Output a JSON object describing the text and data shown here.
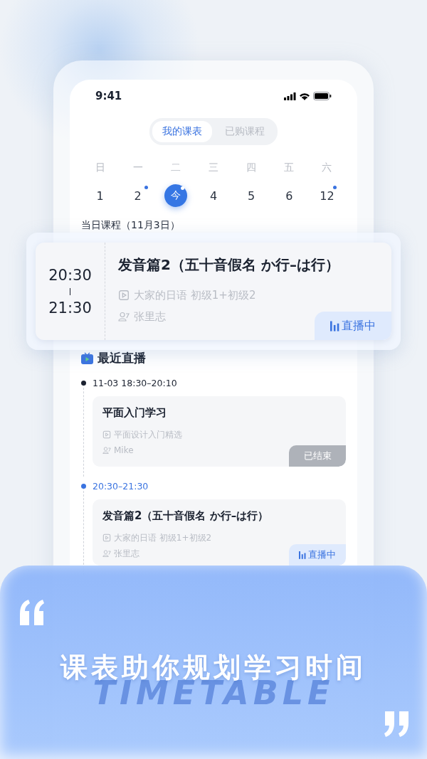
{
  "status_bar": {
    "time": "9:41"
  },
  "tabs": [
    {
      "label": "我的课表",
      "selected": true
    },
    {
      "label": "已购课程",
      "selected": false
    }
  ],
  "weekdays": [
    "日",
    "一",
    "二",
    "三",
    "四",
    "五",
    "六"
  ],
  "dates": [
    {
      "label": "1",
      "today": false,
      "has_class": false
    },
    {
      "label": "2",
      "today": false,
      "has_class": true
    },
    {
      "label": "今",
      "today": true,
      "has_class": true
    },
    {
      "label": "4",
      "today": false,
      "has_class": false
    },
    {
      "label": "5",
      "today": false,
      "has_class": false
    },
    {
      "label": "6",
      "today": false,
      "has_class": false
    },
    {
      "label": "12",
      "today": false,
      "has_class": true
    }
  ],
  "today_section": {
    "title": "当日课程（11月3日）"
  },
  "featured_course": {
    "start": "20:30",
    "end": "21:30",
    "title": "发音篇2（五十音假名 か行–は行）",
    "course": "大家的日语 初级1+初级2",
    "teacher": "张里志",
    "status": {
      "label": "直播中",
      "kind": "live"
    }
  },
  "recent": {
    "title": "最近直播",
    "items": [
      {
        "time": "11-03 18:30–20:10",
        "current": false,
        "title": "平面入门学习",
        "course": "平面设计入门精选",
        "teacher": "Mike",
        "status": {
          "label": "已结束",
          "kind": "ended"
        }
      },
      {
        "time": "20:30–21:30",
        "current": true,
        "title": "发音篇2（五十音假名 か行–は行）",
        "course": "大家的日语 初级1+初级2",
        "teacher": "张里志",
        "status": {
          "label": "直播中",
          "kind": "live"
        }
      }
    ]
  },
  "banner": {
    "headline": "课表助你规划学习时间",
    "backdrop_text": "TIMETABLE"
  }
}
